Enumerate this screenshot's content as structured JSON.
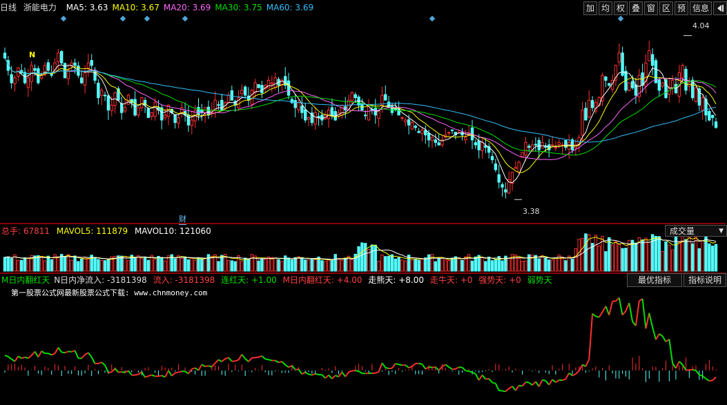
{
  "header": {
    "period": "日线",
    "stock_name": "浙能电力",
    "ma": [
      {
        "label": "MA5: 3.63",
        "color": "#ffffff"
      },
      {
        "label": "MA10: 3.67",
        "color": "#ffff00"
      },
      {
        "label": "MA20: 3.69",
        "color": "#ff66ff"
      },
      {
        "label": "MA30: 3.75",
        "color": "#00e000"
      },
      {
        "label": "MA60: 3.69",
        "color": "#33c0ff"
      }
    ]
  },
  "toolbar": {
    "buttons": [
      "加",
      "均",
      "权",
      "叠",
      "窗",
      "区",
      "预",
      "信息"
    ],
    "close_icon": "close-arrow-icon"
  },
  "main_chart": {
    "high_label": "4.04",
    "low_label": "3.38",
    "fin_marker": "财",
    "top_flag": "N"
  },
  "volume_panel": {
    "labels": [
      {
        "text": "总手: 67811",
        "color": "#ff4040"
      },
      {
        "text": "MAVOL5: 111879",
        "color": "#ffff00"
      },
      {
        "text": "MAVOL10: 121060",
        "color": "#ffffff"
      }
    ],
    "selector": "成交量"
  },
  "indicator_panel": {
    "labels": [
      {
        "text": "M日内翻红天",
        "color": "#00e000"
      },
      {
        "text": "N日内净流入: -3181398",
        "color": "#dddddd"
      },
      {
        "text": "流入: -3181398",
        "color": "#ff4040"
      },
      {
        "text": "连红天: +1.00",
        "color": "#00e000"
      },
      {
        "text": "M日内翻红天: +4.00",
        "color": "#ff4040"
      },
      {
        "text": "走熊天: +8.00",
        "color": "#ffffff"
      },
      {
        "text": "走牛天: +0",
        "color": "#ff4040"
      },
      {
        "text": "强势天: +0",
        "color": "#ff4040"
      },
      {
        "text": "弱势天",
        "color": "#00e000"
      }
    ],
    "best_button": "最优指标",
    "help_button": "指标说明",
    "note": "第一股票公式网最新股票公式下载: www.chnmoney.com"
  },
  "chart_data": {
    "type": "candlestick",
    "title": "浙能电力",
    "x": [
      1,
      2,
      3,
      4,
      5,
      6,
      7,
      8,
      9,
      10,
      11,
      12,
      13,
      14,
      15,
      16,
      17,
      18,
      19,
      20,
      21,
      22,
      23,
      24,
      25,
      26,
      27,
      28,
      29,
      30,
      31,
      32,
      33,
      34,
      35,
      36,
      37,
      38,
      39,
      40,
      41,
      42,
      43,
      44,
      45,
      46,
      47,
      48,
      49,
      50,
      51,
      52,
      53,
      54,
      55,
      56,
      57,
      58,
      59,
      60,
      61,
      62,
      63,
      64,
      65,
      66,
      67,
      68,
      69,
      70,
      71,
      72,
      73,
      74,
      75,
      76,
      77,
      78,
      79,
      80,
      81,
      82,
      83,
      84,
      85,
      86,
      87,
      88,
      89,
      90,
      91,
      92,
      93,
      94,
      95,
      96,
      97,
      98,
      99,
      100,
      101,
      102,
      103,
      104,
      105,
      106,
      107,
      108,
      109,
      110,
      111,
      112,
      113,
      114,
      115,
      116,
      117,
      118,
      119,
      120,
      121,
      122,
      123,
      124,
      125,
      126,
      127,
      128,
      129,
      130,
      131,
      132,
      133,
      134,
      135,
      136,
      137,
      138,
      139,
      140,
      141,
      142,
      143,
      144,
      145,
      146,
      147,
      148,
      149,
      150,
      151,
      152,
      153,
      154,
      155,
      156,
      157,
      158,
      159,
      160,
      161,
      162,
      163,
      164,
      165,
      166,
      167,
      168,
      169,
      170,
      171,
      172,
      173,
      174,
      175,
      176,
      177,
      178,
      179,
      180,
      181,
      182,
      183,
      184,
      185,
      186,
      187,
      188,
      189,
      190,
      191,
      192,
      193,
      194,
      195,
      196,
      197,
      198,
      199,
      200,
      201,
      202,
      203,
      204,
      205,
      206,
      207,
      208,
      209,
      210
    ],
    "close": [
      3.95,
      3.9,
      3.85,
      3.87,
      3.91,
      3.89,
      3.85,
      3.87,
      3.92,
      3.9,
      3.85,
      3.88,
      3.92,
      3.9,
      3.88,
      3.93,
      3.97,
      3.93,
      3.87,
      3.9,
      3.93,
      3.92,
      3.88,
      3.85,
      3.89,
      3.93,
      3.92,
      3.86,
      3.79,
      3.82,
      3.8,
      3.74,
      3.76,
      3.81,
      3.78,
      3.73,
      3.75,
      3.8,
      3.77,
      3.72,
      3.75,
      3.79,
      3.76,
      3.71,
      3.73,
      3.77,
      3.74,
      3.7,
      3.72,
      3.76,
      3.73,
      3.69,
      3.71,
      3.75,
      3.72,
      3.68,
      3.7,
      3.74,
      3.72,
      3.73,
      3.75,
      3.72,
      3.74,
      3.78,
      3.76,
      3.74,
      3.77,
      3.8,
      3.78,
      3.76,
      3.79,
      3.82,
      3.8,
      3.78,
      3.82,
      3.85,
      3.83,
      3.81,
      3.84,
      3.86,
      3.85,
      3.87,
      3.84,
      3.86,
      3.84,
      3.8,
      3.77,
      3.75,
      3.77,
      3.73,
      3.7,
      3.71,
      3.69,
      3.73,
      3.71,
      3.7,
      3.72,
      3.74,
      3.72,
      3.7,
      3.73,
      3.76,
      3.74,
      3.78,
      3.81,
      3.79,
      3.76,
      3.74,
      3.72,
      3.76,
      3.74,
      3.72,
      3.74,
      3.8,
      3.78,
      3.75,
      3.73,
      3.74,
      3.72,
      3.71,
      3.7,
      3.68,
      3.69,
      3.67,
      3.65,
      3.66,
      3.64,
      3.62,
      3.63,
      3.61,
      3.6,
      3.62,
      3.64,
      3.65,
      3.66,
      3.64,
      3.65,
      3.64,
      3.63,
      3.65,
      3.62,
      3.6,
      3.58,
      3.61,
      3.59,
      3.57,
      3.54,
      3.5,
      3.45,
      3.43,
      3.41,
      3.46,
      3.49,
      3.51,
      3.53,
      3.57,
      3.61,
      3.59,
      3.6,
      3.6,
      3.58,
      3.61,
      3.59,
      3.58,
      3.6,
      3.59,
      3.61,
      3.6,
      3.59,
      3.61,
      3.58,
      3.6,
      3.63,
      3.74,
      3.7,
      3.78,
      3.75,
      3.77,
      3.79,
      3.88,
      3.86,
      3.84,
      3.86,
      3.92,
      3.97,
      3.88,
      3.82,
      3.85,
      3.83,
      3.8,
      3.88,
      3.84,
      3.93,
      3.98,
      3.92,
      3.85,
      3.82,
      3.85,
      3.79,
      3.83,
      3.86,
      3.81,
      3.89,
      3.92,
      3.82,
      3.85,
      3.79,
      3.83,
      3.76,
      3.79,
      3.72,
      3.7,
      3.71,
      3.67
    ],
    "ohlc_note": "OHLC estimated from candle bodies; daily K-line chart",
    "ma_series": [
      "MA5",
      "MA10",
      "MA20",
      "MA30",
      "MA60"
    ],
    "high_mark": 4.04,
    "low_mark": 3.38,
    "volume": {
      "series": [
        "总手",
        "MAVOL5",
        "MAVOL10"
      ],
      "latest": [
        67811,
        111879,
        121060
      ]
    },
    "indicator": {
      "series": [
        "M日内翻红天",
        "N日内净流入"
      ],
      "latest_inflow": -3181398
    }
  }
}
